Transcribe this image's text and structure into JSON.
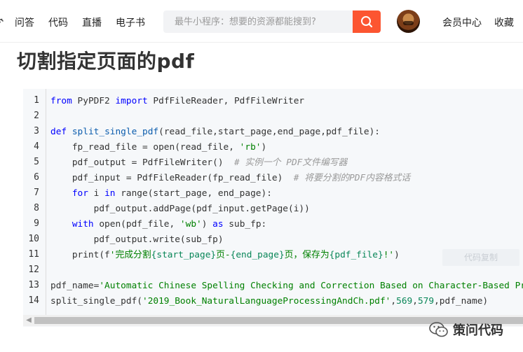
{
  "nav": {
    "partial_left": "ɝ",
    "links": [
      "问答",
      "代码",
      "直播",
      "电子书"
    ],
    "search_placeholder": "最牛小程序：想要的资源都能搜到?",
    "right_links": [
      "会员中心",
      "收藏"
    ]
  },
  "article": {
    "title": "切割指定页面的pdf"
  },
  "code": {
    "line_numbers": [
      "1",
      "2",
      "3",
      "4",
      "5",
      "6",
      "7",
      "8",
      "9",
      "10",
      "11",
      "12",
      "13",
      "14"
    ],
    "copy_hint": "代码复制"
  },
  "watermark": {
    "text": "策问代码"
  },
  "colors": {
    "accent": "#fc5531",
    "code_bg": "#f6f8fa",
    "keyword": "#0000ff",
    "string": "#008000",
    "comment": "#999999"
  }
}
